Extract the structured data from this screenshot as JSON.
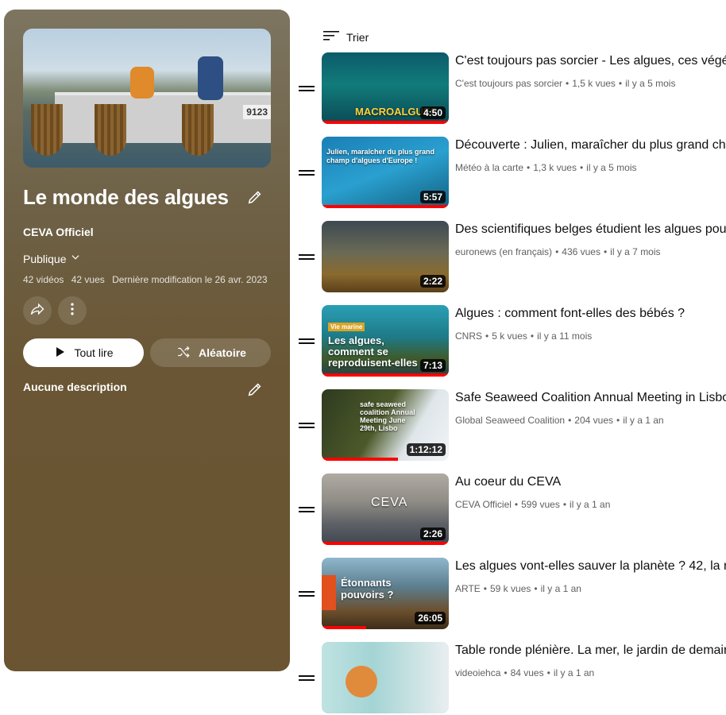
{
  "playlist": {
    "title": "Le monde des algues",
    "owner": "CEVA Officiel",
    "privacy": "Publique",
    "stats": {
      "videos": "42 vidéos",
      "views": "42 vues",
      "modified": "Dernière modification le 26 avr. 2023"
    },
    "cover_tag": "9123",
    "play_all_label": "Tout lire",
    "shuffle_label": "Aléatoire",
    "description": "Aucune description"
  },
  "sort": {
    "label": "Trier"
  },
  "videos": [
    {
      "title": "C'est toujours pas sorcier - Les algues, ces végé",
      "channel": "C'est toujours pas sorcier",
      "views": "1,5 k vues",
      "age": "il y a 5 mois",
      "duration": "4:50",
      "progress": 1.0,
      "caption": "MACROALGUES"
    },
    {
      "title": "Découverte : Julien, maraîcher du plus grand cha",
      "channel": "Météo à la carte",
      "views": "1,3 k vues",
      "age": "il y a 5 mois",
      "duration": "5:57",
      "progress": 1.0,
      "caption": "Julien, maraîcher du plus grand champ d'algues d'Europe !"
    },
    {
      "title": "Des scientifiques belges étudient les algues pou",
      "channel": "euronews (en français)",
      "views": "436 vues",
      "age": "il y a 7 mois",
      "duration": "2:22",
      "progress": 0.0,
      "caption": ""
    },
    {
      "title": "Algues : comment font-elles des bébés ?",
      "channel": "CNRS",
      "views": "5 k vues",
      "age": "il y a 11 mois",
      "duration": "7:13",
      "progress": 1.0,
      "caption": "Les algues, comment se reproduisent-elles",
      "badge": "Vie marine"
    },
    {
      "title": "Safe Seaweed Coalition Annual Meeting in Lisbo",
      "channel": "Global Seaweed Coalition",
      "views": "204 vues",
      "age": "il y a 1 an",
      "duration": "1:12:12",
      "progress": 0.6,
      "caption": "safe seaweed coalition Annual Meeting June 29th, Lisbo"
    },
    {
      "title": "Au coeur du CEVA",
      "channel": "CEVA Officiel",
      "views": "599 vues",
      "age": "il y a 1 an",
      "duration": "2:26",
      "progress": 1.0,
      "caption": "CEVA"
    },
    {
      "title": "Les algues vont-elles sauver la planète ? 42, la r",
      "channel": "ARTE",
      "views": "59 k vues",
      "age": "il y a 1 an",
      "duration": "26:05",
      "progress": 0.35,
      "caption": "Étonnants pouvoirs ?"
    },
    {
      "title": "Table ronde plénière. La mer, le jardin de demair",
      "channel": "videoiehca",
      "views": "84 vues",
      "age": "il y a 1 an",
      "duration": "",
      "progress": 0.0,
      "caption": ""
    }
  ],
  "colors": {
    "panel": "#6a5432",
    "progress": "#ff0000",
    "meta_text": "#606060"
  }
}
